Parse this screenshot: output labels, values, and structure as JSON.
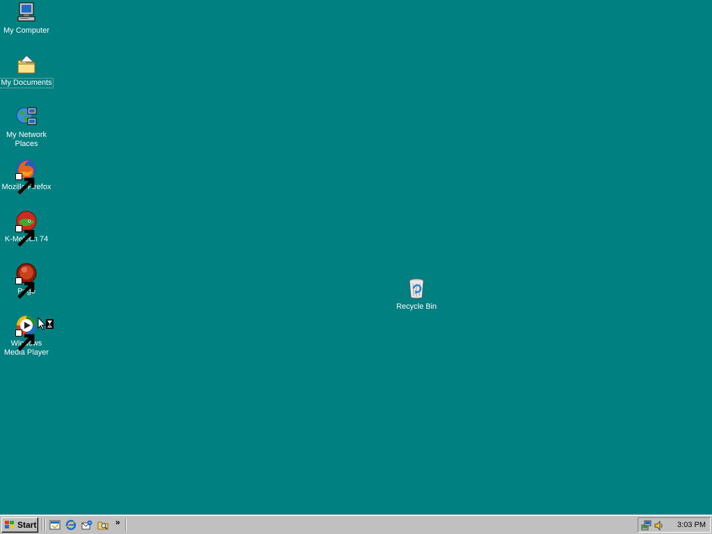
{
  "desktop": {
    "background_color": "#008080",
    "icons": [
      {
        "label": "My Computer",
        "icon": "my-computer-icon"
      },
      {
        "label": "My Documents",
        "icon": "my-documents-icon"
      },
      {
        "label": "My Network\nPlaces",
        "icon": "network-places-icon"
      },
      {
        "label": "Mozilla Firefox",
        "icon": "firefox-icon"
      },
      {
        "label": "K-Meleon 74",
        "icon": "k-meleon-icon"
      },
      {
        "label": "Pego",
        "icon": "pego-icon"
      },
      {
        "label": "Windows\nMedia Player",
        "icon": "media-player-icon"
      },
      {
        "label": "Recycle Bin",
        "icon": "recycle-bin-icon"
      }
    ]
  },
  "taskbar": {
    "start_label": "Start",
    "quick_launch": [
      "show-desktop-icon",
      "internet-explorer-icon",
      "outlook-express-icon",
      "windows-explorer-icon"
    ],
    "overflow_glyph": "»",
    "tray_icons": [
      "network-tray-icon",
      "volume-tray-icon"
    ],
    "clock": "3:03 PM"
  }
}
